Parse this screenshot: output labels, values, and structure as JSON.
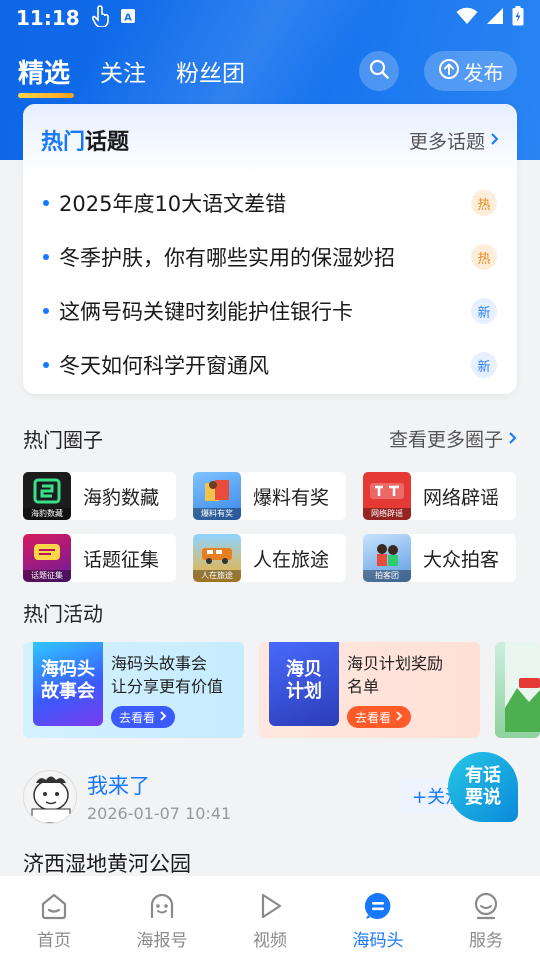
{
  "status_bar": {
    "time": "11:18"
  },
  "top_nav": {
    "tabs": [
      {
        "label": "精选",
        "active": true
      },
      {
        "label": "关注",
        "active": false
      },
      {
        "label": "粉丝团",
        "active": false
      }
    ],
    "publish_label": "发布"
  },
  "hot_topics": {
    "title_prefix": "热门",
    "title_suffix": "话题",
    "more_label": "更多话题",
    "items": [
      {
        "text": "2025年度10大语文差错",
        "badge": "热",
        "badge_type": "hot"
      },
      {
        "text": "冬季护肤，你有哪些实用的保湿妙招",
        "badge": "热",
        "badge_type": "hot"
      },
      {
        "text": "这俩号码关键时刻能护住银行卡",
        "badge": "新",
        "badge_type": "new"
      },
      {
        "text": "冬天如何科学开窗通风",
        "badge": "新",
        "badge_type": "new"
      }
    ]
  },
  "hot_circles": {
    "title": "热门圈子",
    "more_label": "查看更多圈子",
    "items": [
      {
        "name": "海豹数藏",
        "thumb_label": "海豹数藏",
        "color": "#1c1c1c"
      },
      {
        "name": "爆料有奖",
        "thumb_label": "爆料有奖",
        "color": "#3a86e8"
      },
      {
        "name": "网络辟谣",
        "thumb_label": "网络辟谣",
        "color": "#e53935"
      },
      {
        "name": "话题征集",
        "thumb_label": "话题征集",
        "color": "#b0175d"
      },
      {
        "name": "人在旅途",
        "thumb_label": "人在旅途",
        "color": "#f2b132"
      },
      {
        "name": "大众拍客",
        "thumb_label": "拍客团",
        "color": "#5a9be0"
      }
    ]
  },
  "hot_activities": {
    "title": "热门活动",
    "items": [
      {
        "pic_text": "海码头故事会",
        "title_line1": "海码头故事会",
        "title_line2": "让分享更有价值",
        "cta": "去看看"
      },
      {
        "pic_text": "海贝计划",
        "title_line1": "海贝计划奖励",
        "title_line2": "名单",
        "cta": "去看看"
      }
    ]
  },
  "post": {
    "username": "我来了",
    "time": "2026-01-07 10:41",
    "follow_label": "+关注",
    "content": "济西湿地黄河公园"
  },
  "fab": {
    "line1": "有话",
    "line2": "要说"
  },
  "bottom_nav": [
    {
      "label": "首页",
      "icon": "home-icon",
      "active": false
    },
    {
      "label": "海报号",
      "icon": "face-icon",
      "active": false
    },
    {
      "label": "视频",
      "icon": "play-icon",
      "active": false
    },
    {
      "label": "海码头",
      "icon": "chat-icon",
      "active": true
    },
    {
      "label": "服务",
      "icon": "service-icon",
      "active": false
    }
  ]
}
